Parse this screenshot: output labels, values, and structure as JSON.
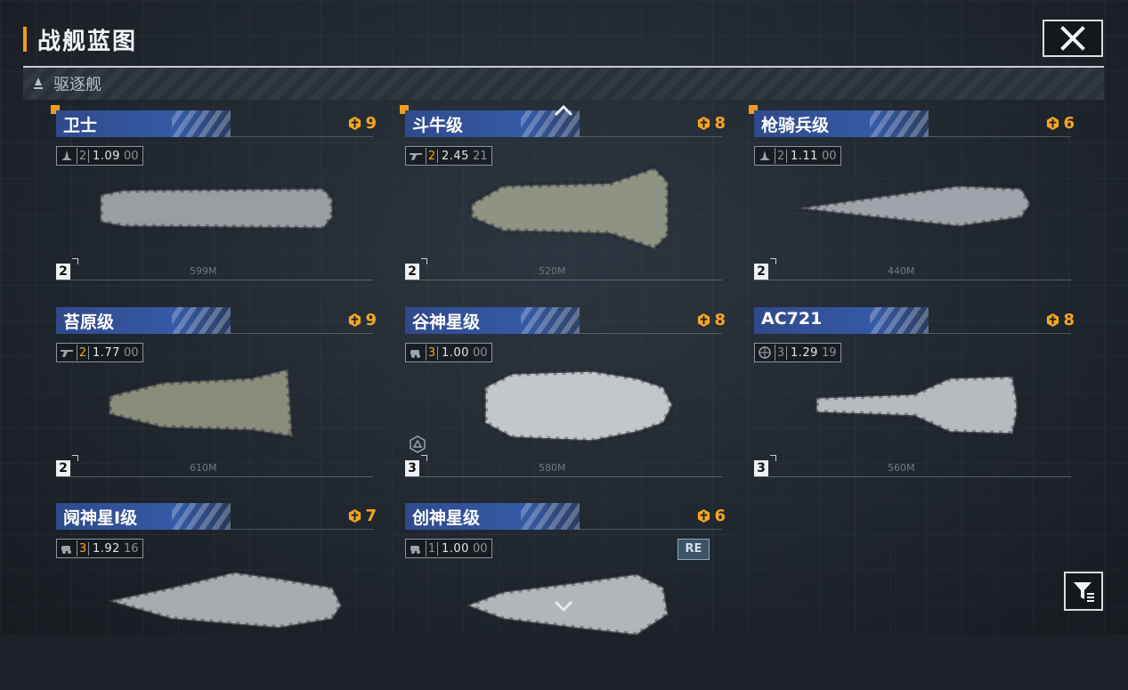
{
  "header": {
    "title": "战舰蓝图",
    "close_icon": "close-icon",
    "accent_color": "#f29a1f"
  },
  "category": {
    "icon": "destroyer-icon",
    "label": "驱逐舰"
  },
  "ships": [
    {
      "name": "卫士",
      "cost": "9",
      "stat_icon": "fighter-icon",
      "tier": "2",
      "value": "1.09",
      "sub": "00",
      "grade": "2",
      "length": "599M",
      "new": true,
      "tier_highlight": false
    },
    {
      "name": "斗牛级",
      "cost": "8",
      "stat_icon": "cannon-icon",
      "tier": "2",
      "value": "2.45",
      "sub": "21",
      "grade": "2",
      "length": "520M",
      "new": true,
      "tier_highlight": true
    },
    {
      "name": "枪骑兵级",
      "cost": "6",
      "stat_icon": "fighter-icon",
      "tier": "2",
      "value": "1.11",
      "sub": "00",
      "grade": "2",
      "length": "440M",
      "new": true,
      "tier_highlight": false
    },
    {
      "name": "苔原级",
      "cost": "9",
      "stat_icon": "cannon-icon",
      "tier": "2",
      "value": "1.77",
      "sub": "00",
      "grade": "2",
      "length": "610M",
      "new": false,
      "tier_highlight": true
    },
    {
      "name": "谷神星级",
      "cost": "8",
      "stat_icon": "vehicle-icon",
      "tier": "3",
      "value": "1.00",
      "sub": "00",
      "grade": "3",
      "length": "580M",
      "new": false,
      "tier_highlight": true
    },
    {
      "name": "AC721",
      "cost": "8",
      "stat_icon": "globe-icon",
      "tier": "3",
      "value": "1.29",
      "sub": "19",
      "grade": "3",
      "length": "560M",
      "new": false,
      "tier_highlight": false
    },
    {
      "name": "阋神星I级",
      "cost": "7",
      "stat_icon": "vehicle-icon",
      "tier": "3",
      "value": "1.92",
      "sub": "16",
      "grade": "",
      "length": "",
      "new": false,
      "tier_highlight": true
    },
    {
      "name": "创神星级",
      "cost": "6",
      "stat_icon": "vehicle-icon",
      "tier": "1",
      "value": "1.00",
      "sub": "00",
      "grade": "",
      "length": "",
      "new": false,
      "tier_highlight": false
    }
  ],
  "re_badge": "RE",
  "cost_color": "#f5a623",
  "filter_icon": "filter-icon"
}
